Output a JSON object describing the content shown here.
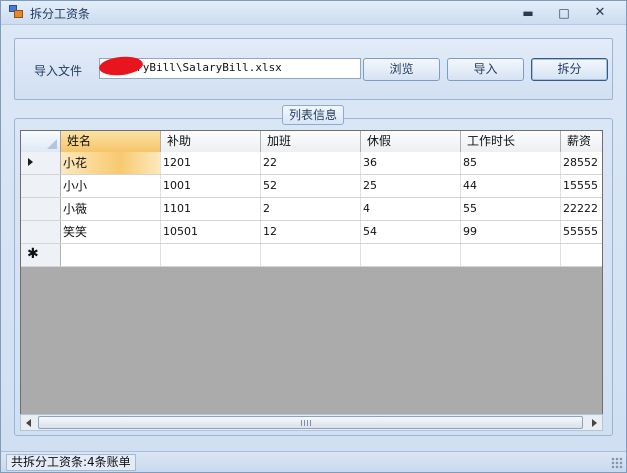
{
  "window": {
    "title": "拆分工资条",
    "minimize_glyph": "▬",
    "maximize_glyph": "□",
    "close_glyph": "✕"
  },
  "import": {
    "label": "导入文件",
    "file_path": "·  ·  aryBill\\SalaryBill.xlsx",
    "browse_label": "浏览",
    "import_label": "导入",
    "split_label": "拆分"
  },
  "list": {
    "title": "列表信息",
    "columns": [
      "姓名",
      "补助",
      "加班",
      "休假",
      "工作时长",
      "薪资"
    ],
    "rows": [
      [
        "小花",
        "1201",
        "22",
        "36",
        "85",
        "28552"
      ],
      [
        "小小",
        "1001",
        "52",
        "25",
        "44",
        "15555"
      ],
      [
        "小薇",
        "1101",
        "2",
        "4",
        "55",
        "22222"
      ],
      [
        "笑笑",
        "10501",
        "12",
        "54",
        "99",
        "55555"
      ]
    ],
    "new_row_marker": "✱"
  },
  "status": {
    "text": "共拆分工资条:4条账单"
  },
  "colors": {
    "accent": "#f8c96f",
    "grid_background": "#ababab",
    "window_background": "#dbe6f4"
  }
}
